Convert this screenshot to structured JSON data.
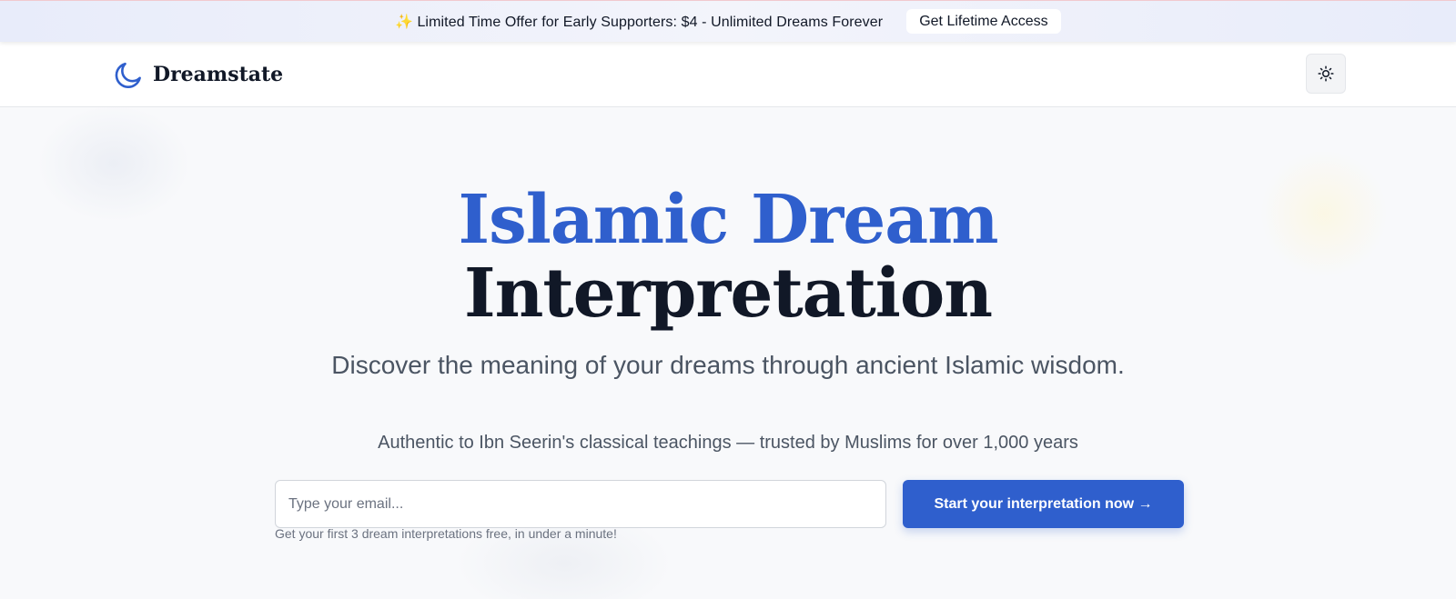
{
  "promo": {
    "sparkle": "✨",
    "text": "Limited Time Offer for Early Supporters: $4 - Unlimited Dreams Forever",
    "button_label": "Get Lifetime Access"
  },
  "nav": {
    "brand_name": "Dreamstate",
    "logo_icon": "moon-icon",
    "theme_toggle_icon": "sun-icon"
  },
  "hero": {
    "title_line1": "Islamic Dream",
    "title_line2": "Interpretation",
    "subtitle": "Discover the meaning of your dreams through ancient Islamic wisdom.",
    "trust_line": "Authentic to Ibn Seerin's classical teachings — trusted by Muslims for over 1,000 years",
    "email_placeholder": "Type your email...",
    "cta_label": "Start your interpretation now →",
    "fine_print": "Get your first 3 dream interpretations free, in under a minute!"
  },
  "colors": {
    "accent": "#2f5fcd",
    "heading": "#111827",
    "body_text": "#4b5563",
    "background": "#f8f9fb"
  }
}
